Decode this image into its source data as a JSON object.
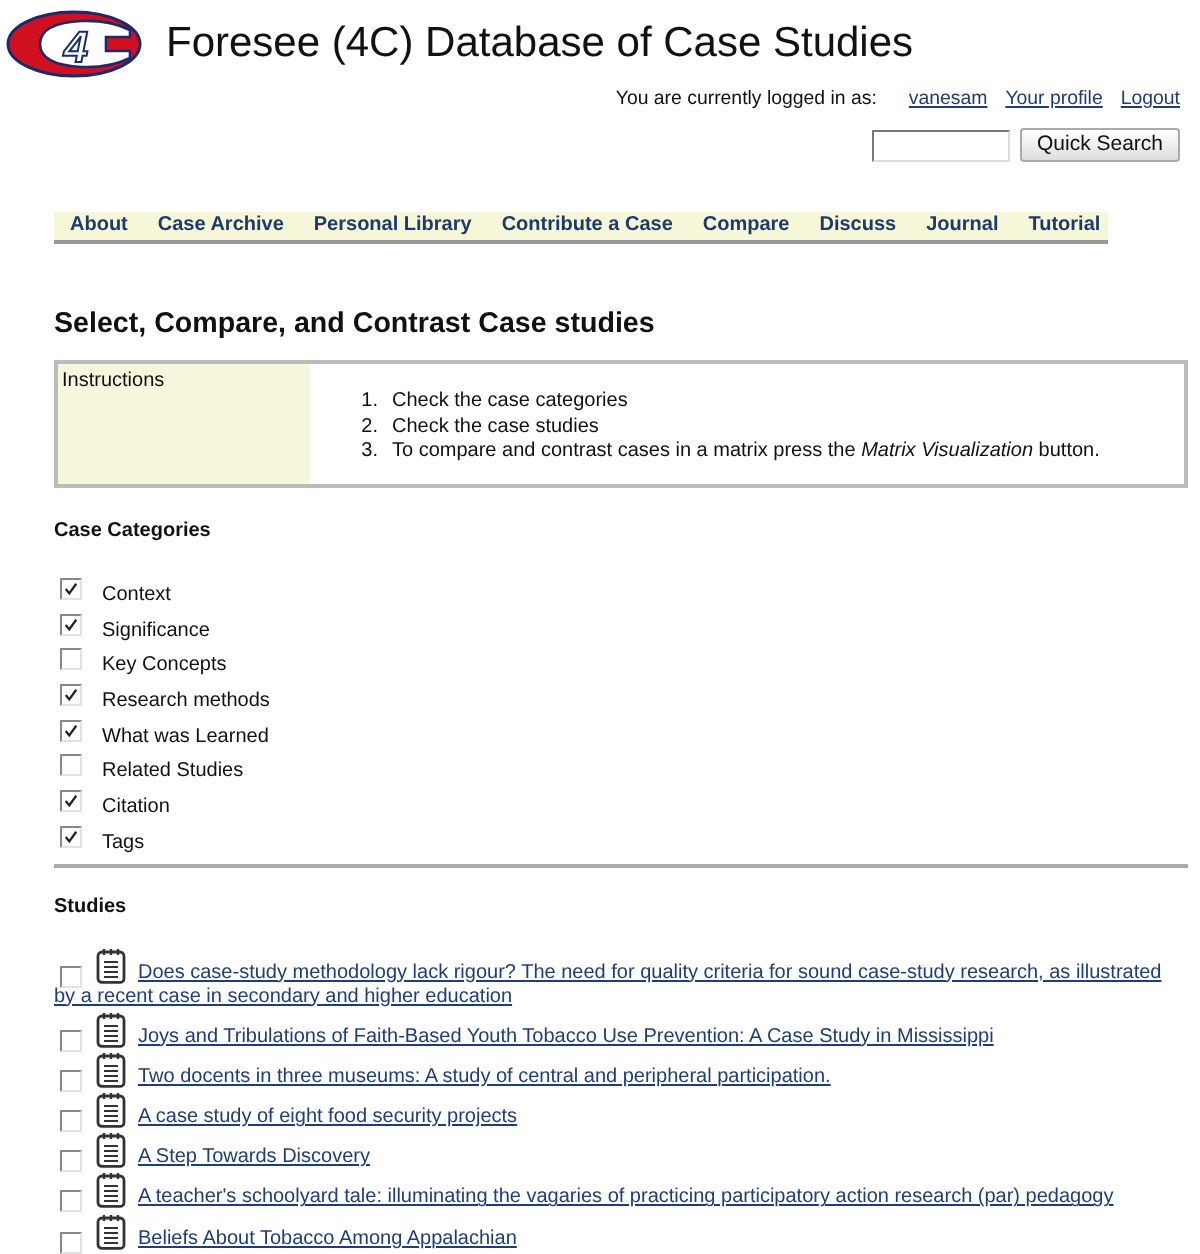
{
  "logo": {
    "text": "4"
  },
  "title": "Foresee (4C) Database of Case Studies",
  "user_bar": {
    "label": "You are currently logged in as:",
    "links": [
      "vanesam",
      "Your profile",
      "Logout"
    ]
  },
  "search": {
    "button": "Quick Search"
  },
  "nav": [
    "About",
    "Case Archive",
    "Personal Library",
    "Contribute a Case",
    "Compare",
    "Discuss",
    "Journal",
    "Tutorial"
  ],
  "heading": "Select, Compare, and Contrast Case studies",
  "instructions": {
    "label": "Instructions",
    "steps": [
      {
        "number": "1.",
        "text": "Check the case categories"
      },
      {
        "number": "2.",
        "text": "Check the case studies"
      },
      {
        "number": "3.",
        "text": "To compare and contrast cases in a matrix press the *Matrix Visualization* button."
      }
    ]
  },
  "categories": {
    "title": "Case Categories",
    "items": [
      {
        "label": "Context",
        "checked": true
      },
      {
        "label": "Significance",
        "checked": true
      },
      {
        "label": "Key Concepts",
        "checked": false
      },
      {
        "label": "Research methods",
        "checked": true
      },
      {
        "label": "What was Learned",
        "checked": true
      },
      {
        "label": "Related Studies",
        "checked": false
      },
      {
        "label": "Citation",
        "checked": true
      },
      {
        "label": "Tags",
        "checked": true
      }
    ]
  },
  "studies": {
    "title": "Studies",
    "items": [
      {
        "title": "Does case-study methodology lack rigour? The need for quality criteria for sound case-study research, as illustrated by a recent case in secondary and higher education",
        "checked": false
      },
      {
        "title": "Joys and Tribulations of Faith-Based Youth Tobacco Use Prevention: A Case Study in Mississippi",
        "checked": false
      },
      {
        "title": "Two docents in three museums: A study of central and peripheral participation.",
        "checked": false
      },
      {
        "title": "A case study of eight food security projects",
        "checked": false
      },
      {
        "title": "A Step Towards Discovery",
        "checked": false
      },
      {
        "title": "A teacher's schoolyard tale: illuminating the vagaries of practicing participatory action research (par) pedagogy",
        "checked": false
      },
      {
        "title": "Beliefs About Tobacco Among Appalachian",
        "checked": false
      }
    ]
  }
}
